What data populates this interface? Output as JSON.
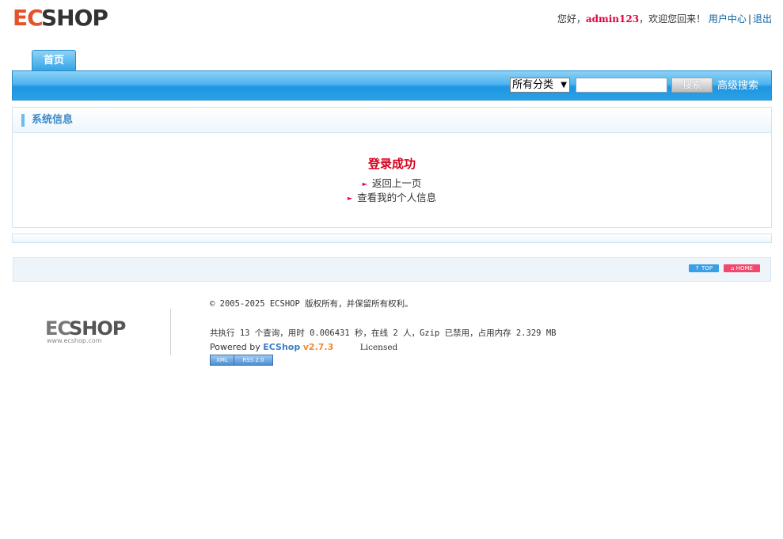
{
  "header": {
    "logo_ec": "EC",
    "logo_shop": "SHOP",
    "greeting": "您好，",
    "username": "admin123",
    "welcome": "，欢迎您回来！",
    "user_center": "用户中心",
    "separator": "|",
    "logout": "退出"
  },
  "nav": {
    "home_tab": "首页"
  },
  "search": {
    "category_selected": "所有分类",
    "keyword_value": "",
    "search_button": "搜索",
    "advanced_search": "高级搜索"
  },
  "sysinfo": {
    "title": "系统信息",
    "message": "登录成功",
    "links": [
      "返回上一页",
      "查看我的个人信息"
    ]
  },
  "footbar": {
    "top_button": "↑ TOP",
    "home_button": "⌂ HOME"
  },
  "footer": {
    "logo_ec": "EC",
    "logo_shop": "SHOP",
    "logo_url": "www.ecshop.com",
    "copyright": "© 2005-2025 ECSHOP 版权所有，并保留所有权利。",
    "stats": "共执行 13 个查询，用时 0.006431 秒，在线 2 人，Gzip 已禁用，占用内存 2.329 MB",
    "powered_by": "Powered by",
    "powered_name": "ECShop",
    "version": "v2.7.3",
    "licensed": "Licensed",
    "feed_xml": "XML",
    "feed_rss": "RSS 2.0"
  },
  "colors": {
    "brand_orange": "#e4532a",
    "nav_blue": "#2fa3e4",
    "success_red": "#d6001c",
    "username_red": "#e4003a",
    "link_blue": "#0b5f9e"
  }
}
